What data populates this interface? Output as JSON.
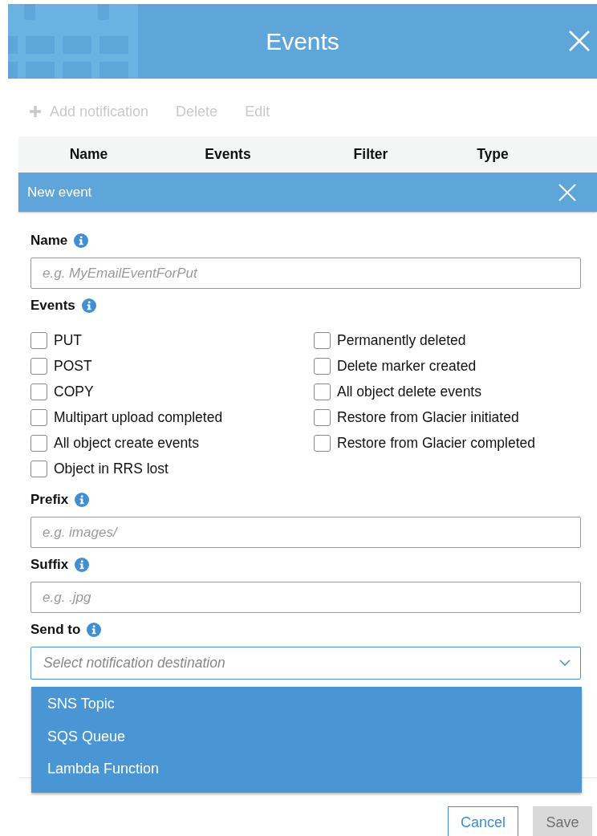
{
  "dialog": {
    "title": "Events"
  },
  "toolbar": [
    {
      "label": "Add notification",
      "kind": "add",
      "disabled": true
    },
    {
      "label": "Delete",
      "kind": "plain",
      "disabled": true
    },
    {
      "label": "Edit",
      "kind": "plain",
      "disabled": true
    }
  ],
  "table": {
    "columns": [
      "Name",
      "Events",
      "Filter",
      "Type"
    ]
  },
  "new_event": {
    "title": "New event"
  },
  "form": {
    "name": {
      "label": "Name",
      "placeholder": "e.g. MyEmailEventForPut"
    },
    "events": {
      "label": "Events",
      "options": [
        {
          "label": "PUT",
          "checked": false
        },
        {
          "label": "POST",
          "checked": false
        },
        {
          "label": "COPY",
          "checked": false
        },
        {
          "label": "Multipart upload completed",
          "checked": false
        },
        {
          "label": "All object create events",
          "checked": false
        },
        {
          "label": "Object in RRS lost",
          "checked": false
        },
        {
          "label": "Permanently deleted",
          "checked": false
        },
        {
          "label": "Delete marker created",
          "checked": false
        },
        {
          "label": "All object delete events",
          "checked": false
        },
        {
          "label": "Restore from Glacier initiated",
          "checked": false
        },
        {
          "label": "Restore from Glacier completed",
          "checked": false
        }
      ]
    },
    "prefix": {
      "label": "Prefix",
      "placeholder": "e.g. images/"
    },
    "suffix": {
      "label": "Suffix",
      "placeholder": "e.g. .jpg"
    },
    "send_to": {
      "label": "Send to",
      "placeholder": "Select notification destination",
      "expanded": true,
      "options": [
        "SNS Topic",
        "SQS Queue",
        "Lambda Function"
      ]
    }
  },
  "buttons": [
    {
      "label": "Cancel",
      "kind": "secondary",
      "disabled": false
    },
    {
      "label": "Save",
      "kind": "primary",
      "disabled": true
    }
  ]
}
